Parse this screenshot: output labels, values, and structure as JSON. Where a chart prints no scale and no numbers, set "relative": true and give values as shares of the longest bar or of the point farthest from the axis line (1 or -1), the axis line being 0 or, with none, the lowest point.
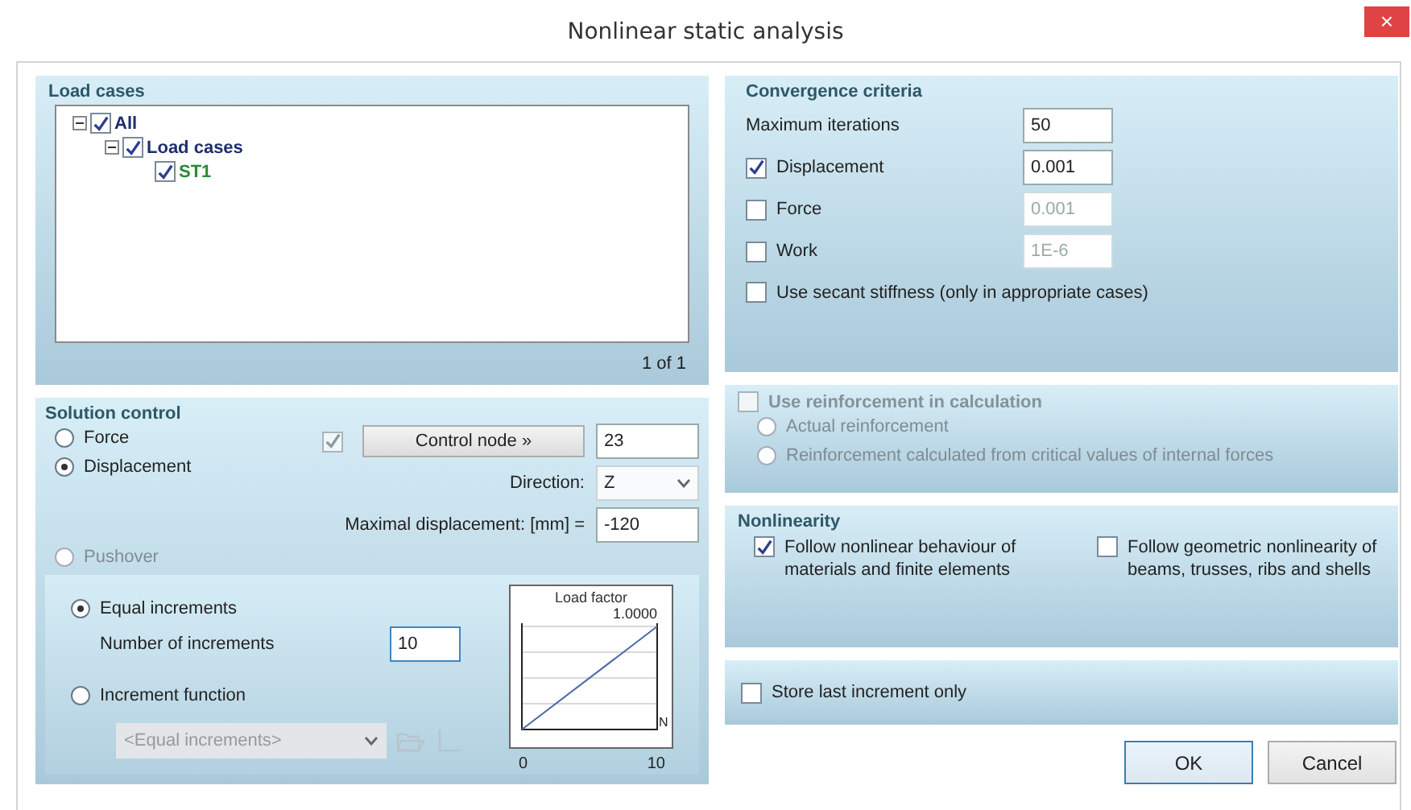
{
  "window": {
    "title": "Nonlinear static analysis",
    "close": "×"
  },
  "load_cases": {
    "title": "Load cases",
    "pager": "1 of 1",
    "tree": [
      {
        "label": "All",
        "kind": "group",
        "checked": true,
        "expanded": true,
        "children": [
          {
            "label": "Load cases",
            "kind": "group",
            "checked": true,
            "expanded": true,
            "children": [
              {
                "label": "ST1",
                "kind": "case",
                "checked": true
              }
            ]
          }
        ]
      }
    ]
  },
  "solution_control": {
    "title": "Solution control",
    "modes": [
      {
        "label": "Force",
        "selected": false,
        "disabled": false
      },
      {
        "label": "Displacement",
        "selected": true,
        "disabled": false
      },
      {
        "label": "Pushover",
        "selected": false,
        "disabled": true
      }
    ],
    "control_node": {
      "checked": true,
      "disabled": true,
      "button": "Control node",
      "button_icon": "»",
      "value": "23"
    },
    "direction": {
      "label": "Direction:",
      "value": "Z"
    },
    "max_displacement": {
      "label": "Maximal displacement: [mm] =",
      "value": "-120"
    },
    "increments": {
      "options": [
        {
          "label": "Equal increments",
          "selected": true
        },
        {
          "label": "Increment function",
          "selected": false
        }
      ],
      "count_label": "Number of increments",
      "count_value": "10",
      "function_value": "<Equal increments>",
      "function_disabled": true
    },
    "chart_data": {
      "type": "line",
      "title": "Load factor",
      "xlabel": "N",
      "x": [
        0,
        10
      ],
      "relative": true,
      "series": [
        {
          "color": "#4a6aa8",
          "values": [
            0,
            1
          ]
        }
      ],
      "xlim": [
        0,
        10
      ],
      "xticks": [
        {
          "value": 0,
          "label": "0"
        },
        {
          "value": 10,
          "label": "10"
        }
      ],
      "annotations": [
        "1.0000"
      ]
    }
  },
  "convergence": {
    "title": "Convergence criteria",
    "max_iterations": {
      "label": "Maximum iterations",
      "value": "50"
    },
    "criteria": [
      {
        "label": "Displacement",
        "checked": true,
        "value": "0.001"
      },
      {
        "label": "Force",
        "checked": false,
        "value": "0.001"
      },
      {
        "label": "Work",
        "checked": false,
        "value": "1E-6"
      }
    ],
    "secant": {
      "label": "Use secant stiffness (only in appropriate cases)",
      "checked": false
    }
  },
  "reinforcement": {
    "label": "Use reinforcement in calculation",
    "checked": false,
    "disabled": true,
    "options": [
      {
        "label": "Actual reinforcement",
        "selected": false
      },
      {
        "label": "Reinforcement calculated from critical values of internal forces",
        "selected": false
      }
    ]
  },
  "nonlinearity": {
    "title": "Nonlinearity",
    "options": [
      {
        "label": "Follow nonlinear behaviour of materials and finite elements",
        "checked": true
      },
      {
        "label": "Follow geometric nonlinearity of beams, trusses, ribs and shells",
        "checked": false
      }
    ]
  },
  "store_last": {
    "label": "Store last increment only",
    "checked": false
  },
  "buttons": [
    {
      "label": "OK",
      "default": true
    },
    {
      "label": "Cancel",
      "default": false
    }
  ]
}
